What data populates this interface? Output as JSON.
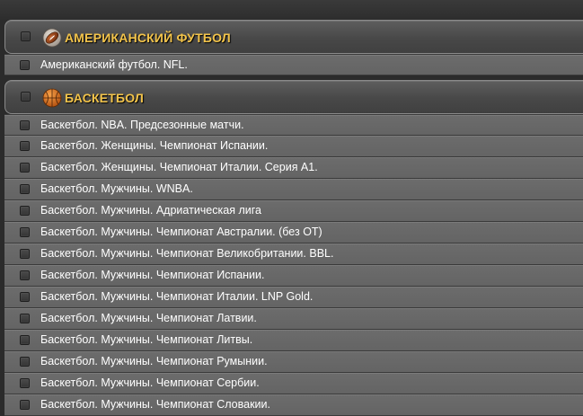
{
  "sections": [
    {
      "title": "АМЕРИКАНСКИЙ ФУТБОЛ",
      "icon": "american-football-icon",
      "items": [
        "Американский футбол. NFL."
      ]
    },
    {
      "title": "БАСКЕТБОЛ",
      "icon": "basketball-icon",
      "items": [
        "Баскетбол. NBA. Предсезонные матчи.",
        "Баскетбол. Женщины. Чемпионат Испании.",
        "Баскетбол. Женщины. Чемпионат Италии. Серия А1.",
        "Баскетбол. Мужчины. WNBA.",
        "Баскетбол. Мужчины. Адриатическая лига",
        "Баскетбол. Мужчины. Чемпионат Австралии. (без ОТ)",
        "Баскетбол. Мужчины. Чемпионат Великобритании. BBL.",
        "Баскетбол. Мужчины. Чемпионат Испании.",
        "Баскетбол. Мужчины. Чемпионат Италии. LNP Gold.",
        "Баскетбол. Мужчины. Чемпионат Латвии.",
        "Баскетбол. Мужчины. Чемпионат Литвы.",
        "Баскетбол. Мужчины. Чемпионат Румынии.",
        "Баскетбол. Мужчины. Чемпионат Сербии.",
        "Баскетбол. Мужчины. Чемпионат Словакии."
      ]
    }
  ],
  "colors": {
    "section_title": "#f2c34a",
    "row_text": "#ffffff",
    "row_bg": "#686868",
    "page_bg": "#2b2b2b"
  }
}
